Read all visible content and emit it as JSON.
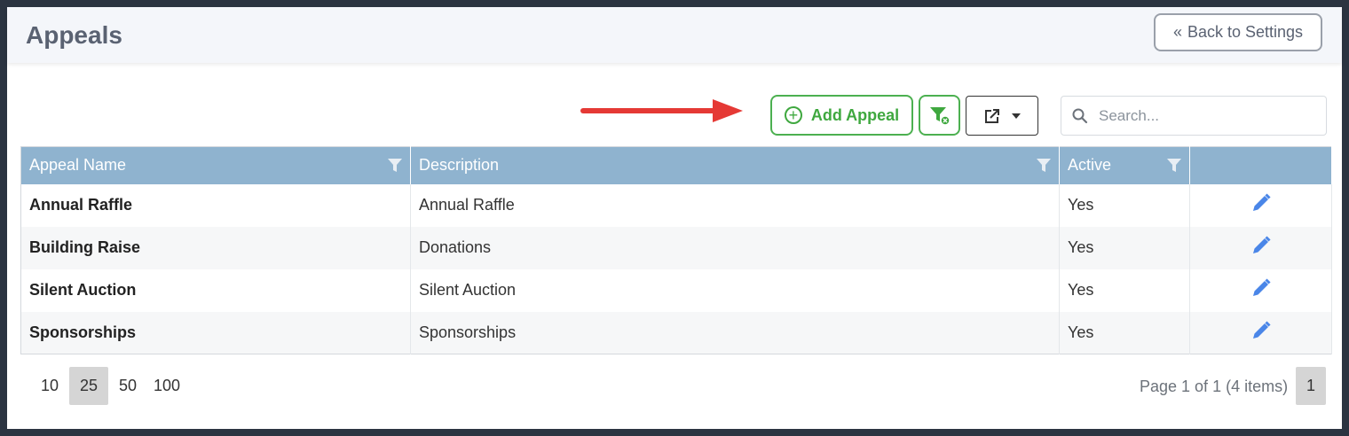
{
  "header": {
    "title": "Appeals",
    "back_label": "Back to Settings"
  },
  "toolbar": {
    "add_label": "Add Appeal",
    "search_placeholder": "Search..."
  },
  "table": {
    "columns": [
      "Appeal Name",
      "Description",
      "Active",
      ""
    ],
    "rows": [
      {
        "name": "Annual Raffle",
        "description": "Annual Raffle",
        "active": "Yes"
      },
      {
        "name": "Building Raise",
        "description": "Donations",
        "active": "Yes"
      },
      {
        "name": "Silent Auction",
        "description": "Silent Auction",
        "active": "Yes"
      },
      {
        "name": "Sponsorships",
        "description": "Sponsorships",
        "active": "Yes"
      }
    ]
  },
  "pager": {
    "sizes": [
      "10",
      "25",
      "50",
      "100"
    ],
    "selected_size": "25",
    "info": "Page 1 of 1 (4 items)",
    "current_page": "1"
  },
  "colors": {
    "accent_green": "#4cb050",
    "header_blue": "#8fb3cf",
    "edit_blue": "#4a86e8",
    "annotation_red": "#e53935"
  },
  "icons": {
    "back": "double-chevron-left-icon",
    "add": "plus-circle-icon",
    "filter_clear": "filter-clear-icon",
    "export": "export-icon",
    "search": "search-icon",
    "column_filter": "filter-icon",
    "edit": "pencil-icon"
  }
}
